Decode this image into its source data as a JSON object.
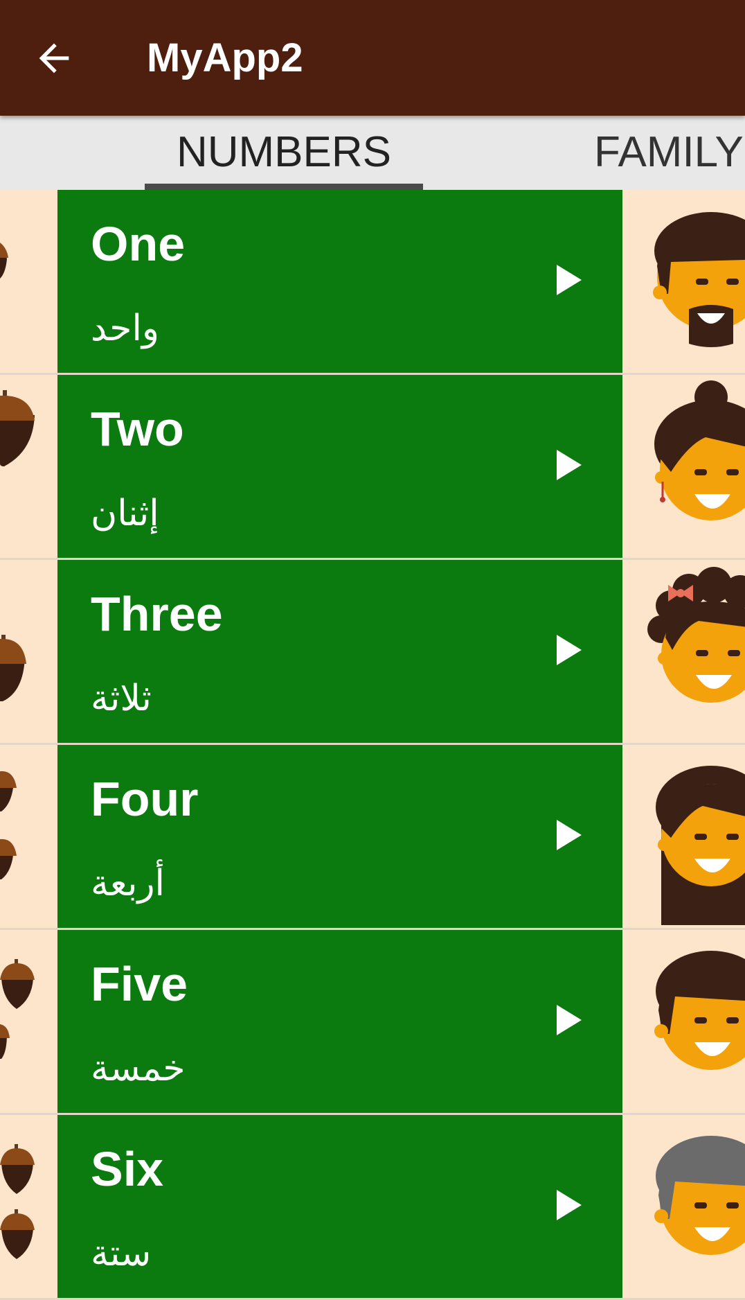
{
  "app_bar": {
    "title": "MyApp2",
    "back_icon": "arrow-back-icon",
    "background": "#4e1e0f"
  },
  "tabs": [
    {
      "label": "NUMBERS",
      "selected": true
    },
    {
      "label": "FAMILY",
      "selected": false
    }
  ],
  "list": {
    "item_color": "#0b7b10",
    "items": [
      {
        "english": "One",
        "arabic": "واحد",
        "play_icon": "play-icon",
        "left_image": "acorn-icon",
        "right_image": "father-face-icon"
      },
      {
        "english": "Two",
        "arabic": "إثنان",
        "play_icon": "play-icon",
        "left_image": "acorn-icon",
        "right_image": "mother-face-icon"
      },
      {
        "english": "Three",
        "arabic": "ثلاثة",
        "play_icon": "play-icon",
        "left_image": "acorn-icon",
        "right_image": "daughter-face-icon"
      },
      {
        "english": "Four",
        "arabic": "أربعة",
        "play_icon": "play-icon",
        "left_image": "acorn-icon",
        "right_image": "older-sister-face-icon"
      },
      {
        "english": "Five",
        "arabic": "خمسة",
        "play_icon": "play-icon",
        "left_image": "acorn-icon",
        "right_image": "son-face-icon"
      },
      {
        "english": "Six",
        "arabic": "ستة",
        "play_icon": "play-icon",
        "left_image": "acorn-icon",
        "right_image": "grandfather-face-icon"
      }
    ]
  }
}
